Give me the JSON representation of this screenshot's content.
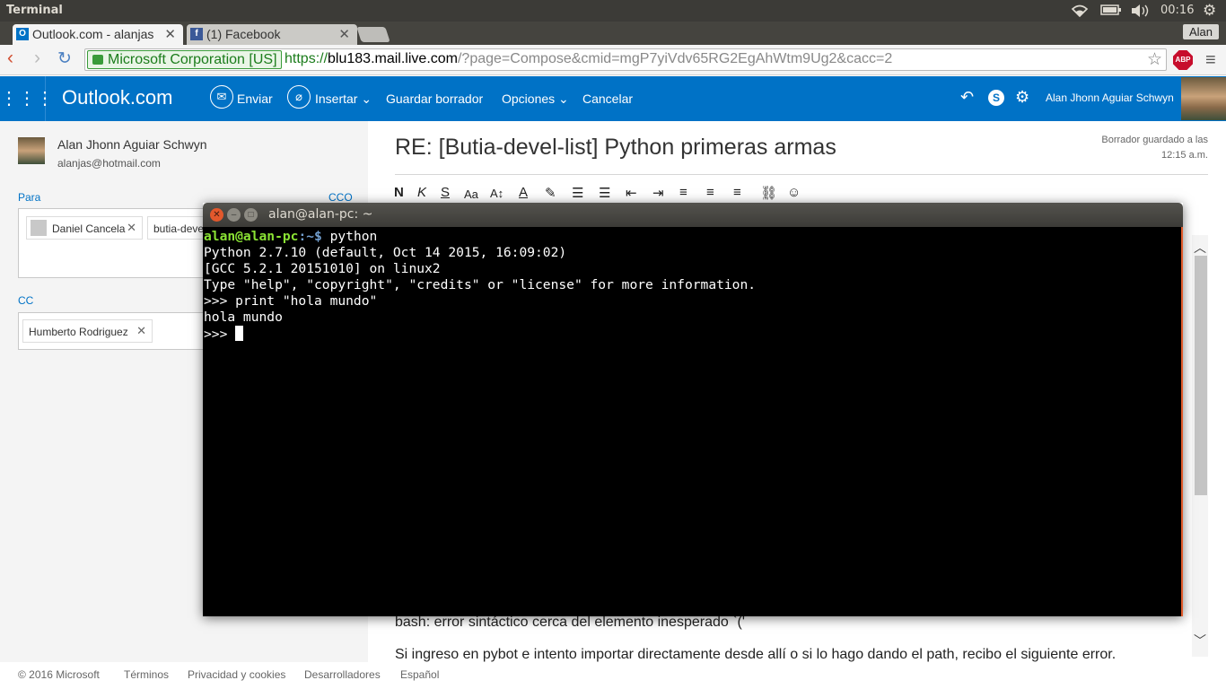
{
  "topbar": {
    "app_title": "Terminal",
    "time": "00:16"
  },
  "browser": {
    "tabs": [
      {
        "label": "Outlook.com - alanjas"
      },
      {
        "label": "(1) Facebook"
      }
    ],
    "profile": "Alan",
    "ev_cert": "Microsoft Corporation [US]",
    "url": {
      "scheme": "https://",
      "host": "blu183.mail.live.com",
      "path": "/?page=Compose&cmid=mgP7yiVdv65RG2EgAhWtm9Ug2&cacc=2"
    },
    "abp": "ABP"
  },
  "outlook": {
    "brand": "Outlook.com",
    "toolbar": {
      "send": "Enviar",
      "insert": "Insertar",
      "save_draft": "Guardar borrador",
      "options": "Opciones",
      "cancel": "Cancelar"
    },
    "user_name": "Alan Jhonn Aguiar Schwyn"
  },
  "sender": {
    "name": "Alan Jhonn Aguiar Schwyn",
    "email": "alanjas@hotmail.com"
  },
  "recipients": {
    "to_label": "Para",
    "cco_label": "CCO",
    "to": [
      "Daniel Cancela",
      "butia-devel-list"
    ],
    "cc_label": "CC",
    "cc": [
      "Humberto Rodriguez"
    ]
  },
  "compose": {
    "subject": "RE: [Butia-devel-list] Python primeras armas",
    "saved_status": {
      "line1": "Borrador guardado a las",
      "line2": "12:15 a.m."
    },
    "body_lines": [
      "bash: error sintáctico cerca del elemento inesperado `('",
      "Si ingreso en pybot e intento importar directamente desde allí o si lo hago dando el path, recibo el siguiente error."
    ]
  },
  "footer": {
    "copyright": "© 2016 Microsoft",
    "links": [
      "Términos",
      "Privacidad y cookies",
      "Desarrolladores",
      "Español"
    ]
  },
  "terminal": {
    "title": "alan@alan-pc: ~",
    "prompt_user": "alan@alan-pc",
    "prompt_path": ":~$ ",
    "command": "python",
    "output": [
      "Python 2.7.10 (default, Oct 14 2015, 16:09:02)",
      "[GCC 5.2.1 20151010] on linux2",
      "Type \"help\", \"copyright\", \"credits\" or \"license\" for more information.",
      ">>> print \"hola mundo\"",
      "hola mundo"
    ],
    "repl_prompt": ">>> "
  }
}
